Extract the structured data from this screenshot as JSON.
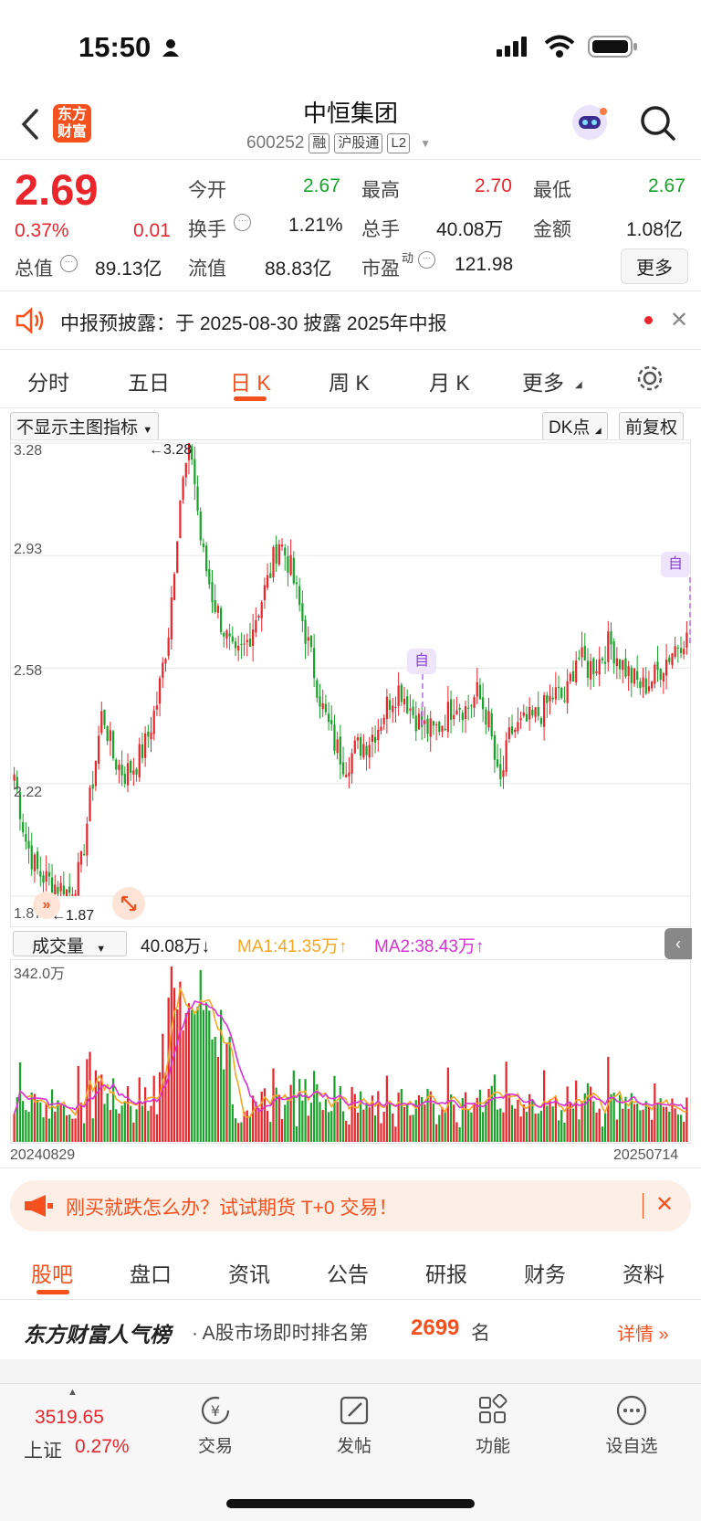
{
  "status_bar": {
    "time": "15:50"
  },
  "header": {
    "logo_text": "东方财富",
    "stock_name": "中恒集团",
    "stock_code": "600252",
    "tags": [
      "融",
      "沪股通",
      "L2"
    ]
  },
  "quote": {
    "price": "2.69",
    "change_pct": "0.37%",
    "change": "0.01",
    "total_value_label": "总值",
    "total_value": "89.13亿",
    "open_label": "今开",
    "open": "2.67",
    "turnover_label": "换手",
    "turnover": "1.21%",
    "float_label": "流值",
    "float": "88.83亿",
    "high_label": "最高",
    "high": "2.70",
    "volume_label": "总手",
    "volume": "40.08万",
    "pe_label": "市盈",
    "pe_sup": "动",
    "pe": "121.98",
    "low_label": "最低",
    "low": "2.67",
    "amount_label": "金额",
    "amount": "1.08亿",
    "more_label": "更多"
  },
  "notice": {
    "text": "中报预披露：于 2025-08-30 披露 2025年中报"
  },
  "chart_tabs": [
    {
      "label": "分时"
    },
    {
      "label": "五日"
    },
    {
      "label": "日 K",
      "active": true
    },
    {
      "label": "周 K"
    },
    {
      "label": "月 K"
    },
    {
      "label": "更多"
    }
  ],
  "chart_controls": {
    "indicator": "不显示主图指标",
    "dk": "DK点",
    "adjust": "前复权"
  },
  "kline": {
    "y_labels": [
      "3.28",
      "2.93",
      "2.58",
      "2.22",
      "1.87"
    ],
    "max_mark": "3.28",
    "min_mark": "1.87",
    "self_label": "自"
  },
  "volume_panel": {
    "selector": "成交量",
    "vol": "40.08万↓",
    "ma1": "MA1:41.35万↑",
    "ma2": "MA2:38.43万↑",
    "max_label": "342.0万",
    "date_start": "20240829",
    "date_end": "20250714"
  },
  "chart_data": {
    "type": "candlestick",
    "xlabel": "",
    "ylabel": "",
    "ylim": [
      1.87,
      3.28
    ],
    "x_range": [
      "20240829",
      "20250714"
    ],
    "close_path": [
      2.25,
      2.05,
      1.95,
      1.92,
      1.9,
      1.88,
      1.95,
      2.2,
      2.45,
      2.3,
      2.25,
      2.28,
      2.35,
      2.48,
      2.7,
      3.1,
      3.28,
      2.95,
      2.8,
      2.7,
      2.6,
      2.65,
      2.75,
      2.85,
      2.98,
      2.9,
      2.75,
      2.6,
      2.45,
      2.35,
      2.28,
      2.33,
      2.35,
      2.4,
      2.48,
      2.52,
      2.45,
      2.4,
      2.38,
      2.42,
      2.48,
      2.45,
      2.5,
      2.42,
      2.2,
      2.38,
      2.4,
      2.42,
      2.45,
      2.5,
      2.48,
      2.62,
      2.58,
      2.6,
      2.66,
      2.6,
      2.55,
      2.52,
      2.55,
      2.6,
      2.65,
      2.69
    ],
    "volume_max": "342.0万"
  },
  "promo": {
    "text": "刚买就跌怎么办？试试期货 T+0 交易！"
  },
  "bottom_tabs": [
    {
      "label": "股吧",
      "active": true
    },
    {
      "label": "盘口"
    },
    {
      "label": "资讯"
    },
    {
      "label": "公告"
    },
    {
      "label": "研报"
    },
    {
      "label": "财务"
    },
    {
      "label": "资料"
    }
  ],
  "ranking": {
    "brand": "东方财富人气榜",
    "prefix": "· A股市场即时排名第",
    "rank": "2699",
    "suffix": "名",
    "detail": "详情"
  },
  "bottom_bar": {
    "index_value": "3519.65",
    "index_name": "上证",
    "index_change": "0.27%",
    "items": [
      {
        "label": "交易"
      },
      {
        "label": "发帖"
      },
      {
        "label": "功能"
      },
      {
        "label": "设自选"
      }
    ]
  },
  "colors": {
    "up": "#e8262c",
    "down": "#1aa32a",
    "accent": "#ff6a00",
    "ma1": "#f5a623",
    "ma2": "#d632d6"
  }
}
